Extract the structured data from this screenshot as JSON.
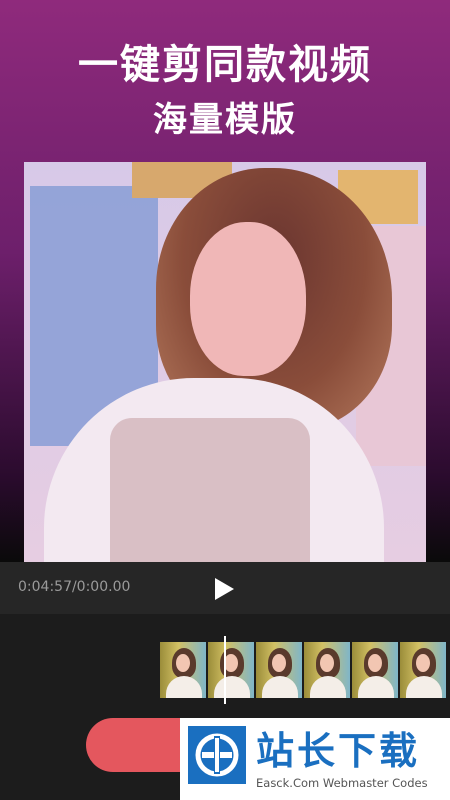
{
  "hero": {
    "title": "一键剪同款视频",
    "subtitle": "海量模版"
  },
  "player": {
    "timecode": "0:04:57/0:00.00",
    "play_icon": "play-icon"
  },
  "timeline": {
    "frames": 6
  },
  "actions": {
    "primary_label": ""
  },
  "watermark": {
    "brand_cn": "站长下载",
    "brand_en": "Easck.Com Webmaster Codes",
    "logo_icon": "easck-logo-icon"
  },
  "colors": {
    "accent": "#e4575e",
    "brand_blue": "#1a6fc0",
    "hero_top": "#8f2a7c"
  }
}
